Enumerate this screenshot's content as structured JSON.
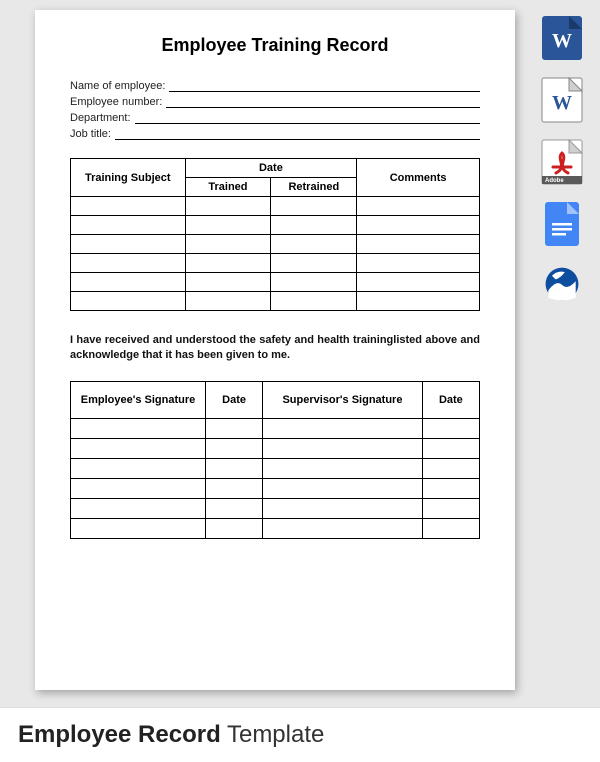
{
  "document": {
    "title": "Employee Training Record",
    "fields": {
      "name_label": "Name of employee:",
      "number_label": "Employee number:",
      "department_label": "Department:",
      "job_title_label": "Job title:"
    },
    "training_table": {
      "headers": {
        "subject": "Training Subject",
        "date": "Date",
        "trained": "Trained",
        "retrained": "Retrained",
        "comments": "Comments"
      },
      "blank_rows": 6
    },
    "declaration": "I have received and understood the safety and health traininglisted above and acknowledge that it has been given to me.",
    "signature_table": {
      "headers": {
        "emp_sig": "Employee's Signature",
        "date1": "Date",
        "sup_sig": "Supervisor's Signature",
        "date2": "Date"
      },
      "blank_rows": 6
    }
  },
  "footer": {
    "bold": "Employee Record",
    "light": " Template"
  },
  "icons": [
    {
      "name": "word-new-icon",
      "type": "word-blue"
    },
    {
      "name": "word-old-icon",
      "type": "word-white"
    },
    {
      "name": "pdf-icon",
      "type": "pdf"
    },
    {
      "name": "google-docs-icon",
      "type": "gdocs"
    },
    {
      "name": "openoffice-icon",
      "type": "ooffice"
    }
  ]
}
